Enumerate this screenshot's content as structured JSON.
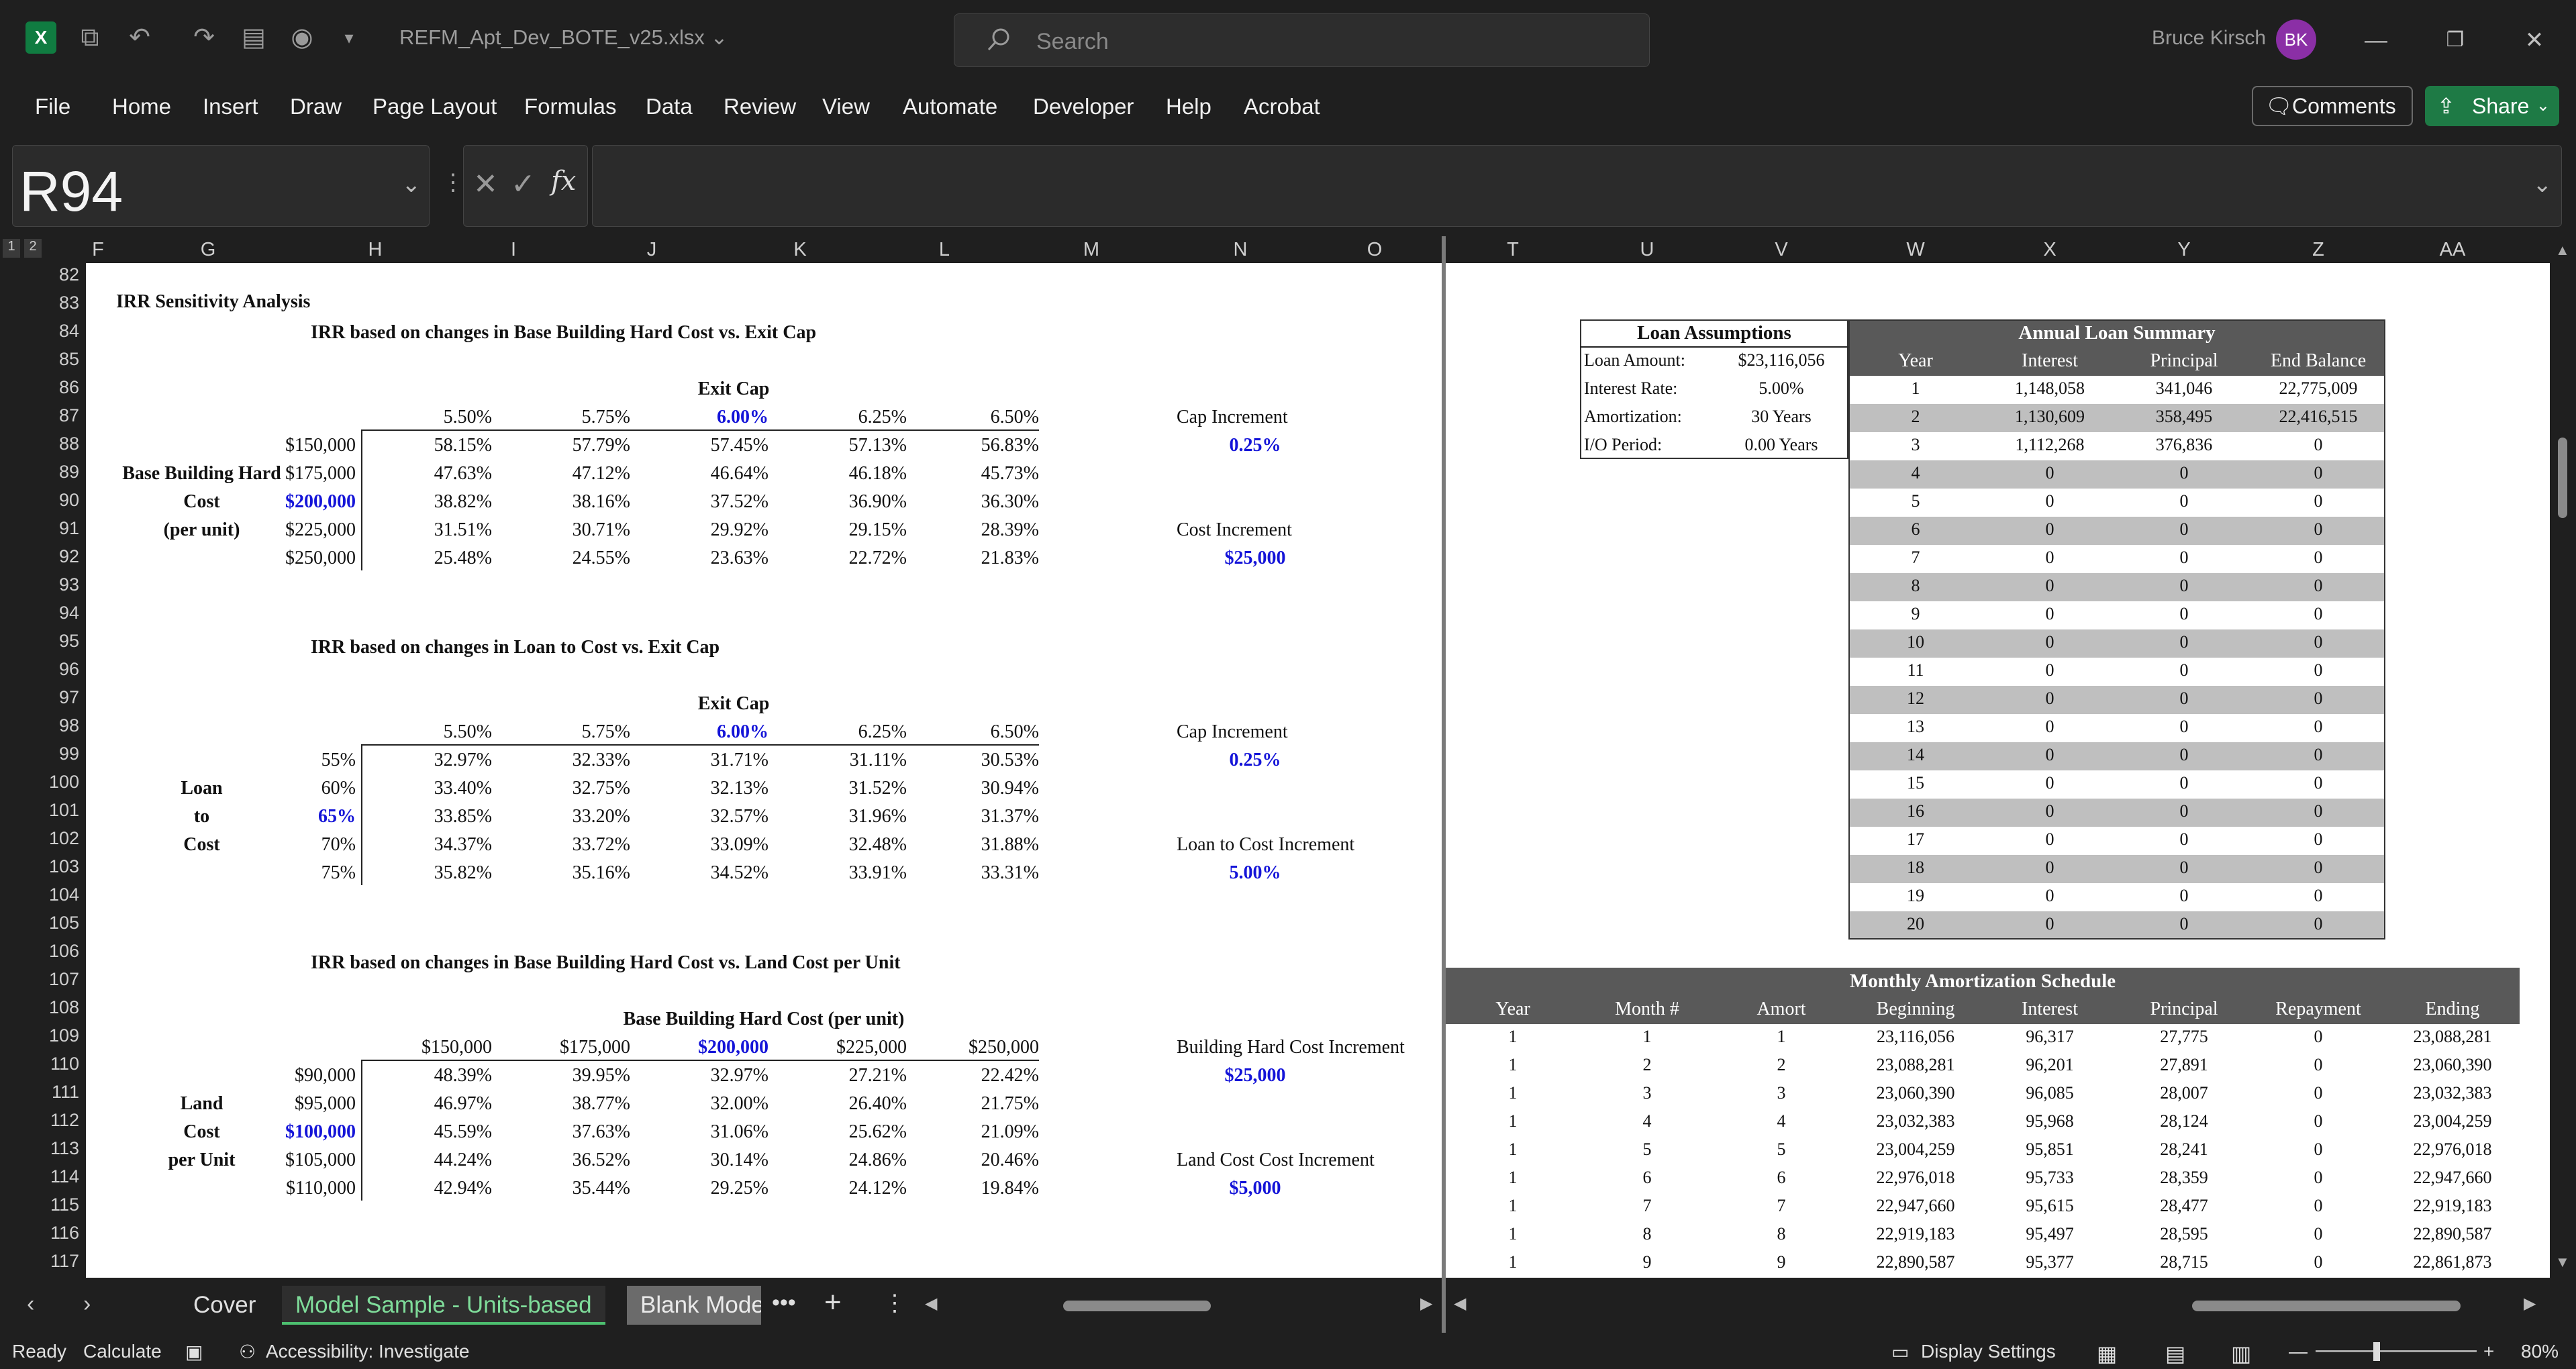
{
  "titlebar": {
    "file_name": "REFM_Apt_Dev_BOTE_v25.xlsx",
    "search_placeholder": "Search",
    "user_name": "Bruce Kirsch",
    "user_initials": "BK"
  },
  "menu": [
    "File",
    "Home",
    "Insert",
    "Draw",
    "Page Layout",
    "Formulas",
    "Data",
    "Review",
    "View",
    "Automate",
    "Developer",
    "Help",
    "Acrobat"
  ],
  "comments_label": "Comments",
  "share_label": "Share",
  "formula_bar": {
    "name_box": "R94",
    "fx": "fx",
    "formula": ""
  },
  "columns_left": [
    "F",
    "G",
    "H",
    "I",
    "J",
    "K",
    "L",
    "M",
    "N",
    "O"
  ],
  "columns_right": [
    "T",
    "U",
    "V",
    "W",
    "X",
    "Y",
    "Z",
    "AA"
  ],
  "outline_levels": [
    "1",
    "2"
  ],
  "rows": [
    "82",
    "83",
    "84",
    "85",
    "86",
    "87",
    "88",
    "89",
    "90",
    "91",
    "92",
    "93",
    "94",
    "95",
    "96",
    "97",
    "98",
    "99",
    "100",
    "101",
    "102",
    "103",
    "104",
    "105",
    "106",
    "107",
    "108",
    "109",
    "110",
    "111",
    "112",
    "113",
    "114",
    "115",
    "116",
    "117"
  ],
  "section_title": "IRR Sensitivity Analysis",
  "tables": [
    {
      "title": "IRR based on changes in Base Building Hard Cost vs. Exit Cap",
      "col_header": "Exit Cap",
      "cols": [
        "5.50%",
        "5.75%",
        "6.00%",
        "6.25%",
        "6.50%"
      ],
      "row_label": [
        "Base Building Hard",
        "Cost",
        "(per unit)"
      ],
      "rows": [
        "$150,000",
        "$175,000",
        "$200,000",
        "$225,000",
        "$250,000"
      ],
      "values": [
        [
          "58.15%",
          "57.79%",
          "57.45%",
          "57.13%",
          "56.83%"
        ],
        [
          "47.63%",
          "47.12%",
          "46.64%",
          "46.18%",
          "45.73%"
        ],
        [
          "38.82%",
          "38.16%",
          "37.52%",
          "36.90%",
          "36.30%"
        ],
        [
          "31.51%",
          "30.71%",
          "29.92%",
          "29.15%",
          "28.39%"
        ],
        [
          "25.48%",
          "24.55%",
          "23.63%",
          "22.72%",
          "21.83%"
        ]
      ],
      "inc1_label": "Cap Increment",
      "inc1_value": "0.25%",
      "inc2_label": "Cost Increment",
      "inc2_value": "$25,000"
    },
    {
      "title": "IRR based on changes in Loan to Cost vs. Exit Cap",
      "col_header": "Exit Cap",
      "cols": [
        "5.50%",
        "5.75%",
        "6.00%",
        "6.25%",
        "6.50%"
      ],
      "row_label": [
        "Loan",
        "to",
        "Cost"
      ],
      "rows": [
        "55%",
        "60%",
        "65%",
        "70%",
        "75%"
      ],
      "values": [
        [
          "32.97%",
          "32.33%",
          "31.71%",
          "31.11%",
          "30.53%"
        ],
        [
          "33.40%",
          "32.75%",
          "32.13%",
          "31.52%",
          "30.94%"
        ],
        [
          "33.85%",
          "33.20%",
          "32.57%",
          "31.96%",
          "31.37%"
        ],
        [
          "34.37%",
          "33.72%",
          "33.09%",
          "32.48%",
          "31.88%"
        ],
        [
          "35.82%",
          "35.16%",
          "34.52%",
          "33.91%",
          "33.31%"
        ]
      ],
      "inc1_label": "Cap Increment",
      "inc1_value": "0.25%",
      "inc2_label": "Loan to Cost Increment",
      "inc2_value": "5.00%"
    },
    {
      "title": "IRR based on changes in Base Building Hard Cost vs. Land Cost per Unit",
      "col_header": "Base Building Hard Cost (per unit)",
      "cols": [
        "$150,000",
        "$175,000",
        "$200,000",
        "$225,000",
        "$250,000"
      ],
      "row_label": [
        "Land",
        "Cost",
        "per Unit"
      ],
      "rows": [
        "$90,000",
        "$95,000",
        "$100,000",
        "$105,000",
        "$110,000"
      ],
      "values": [
        [
          "48.39%",
          "39.95%",
          "32.97%",
          "27.21%",
          "22.42%"
        ],
        [
          "46.97%",
          "38.77%",
          "32.00%",
          "26.40%",
          "21.75%"
        ],
        [
          "45.59%",
          "37.63%",
          "31.06%",
          "25.62%",
          "21.09%"
        ],
        [
          "44.24%",
          "36.52%",
          "30.14%",
          "24.86%",
          "20.46%"
        ],
        [
          "42.94%",
          "35.44%",
          "29.25%",
          "24.12%",
          "19.84%"
        ]
      ],
      "inc1_label": "Building Hard Cost Increment",
      "inc1_value": "$25,000",
      "inc2_label": "Land Cost Cost Increment",
      "inc2_value": "$5,000"
    }
  ],
  "loan_assumptions": {
    "title": "Loan Assumptions",
    "items": [
      [
        "Loan Amount:",
        "$23,116,056"
      ],
      [
        "Interest Rate:",
        "5.00%"
      ],
      [
        "Amortization:",
        "30 Years"
      ],
      [
        "I/O Period:",
        "0.00 Years"
      ]
    ]
  },
  "annual_summary": {
    "title": "Annual Loan Summary",
    "headers": [
      "Year",
      "Interest",
      "Principal",
      "End Balance"
    ],
    "rows": [
      [
        "1",
        "1,148,058",
        "341,046",
        "22,775,009"
      ],
      [
        "2",
        "1,130,609",
        "358,495",
        "22,416,515"
      ],
      [
        "3",
        "1,112,268",
        "376,836",
        "0"
      ],
      [
        "4",
        "0",
        "0",
        "0"
      ],
      [
        "5",
        "0",
        "0",
        "0"
      ],
      [
        "6",
        "0",
        "0",
        "0"
      ],
      [
        "7",
        "0",
        "0",
        "0"
      ],
      [
        "8",
        "0",
        "0",
        "0"
      ],
      [
        "9",
        "0",
        "0",
        "0"
      ],
      [
        "10",
        "0",
        "0",
        "0"
      ],
      [
        "11",
        "0",
        "0",
        "0"
      ],
      [
        "12",
        "0",
        "0",
        "0"
      ],
      [
        "13",
        "0",
        "0",
        "0"
      ],
      [
        "14",
        "0",
        "0",
        "0"
      ],
      [
        "15",
        "0",
        "0",
        "0"
      ],
      [
        "16",
        "0",
        "0",
        "0"
      ],
      [
        "17",
        "0",
        "0",
        "0"
      ],
      [
        "18",
        "0",
        "0",
        "0"
      ],
      [
        "19",
        "0",
        "0",
        "0"
      ],
      [
        "20",
        "0",
        "0",
        "0"
      ]
    ]
  },
  "monthly_schedule": {
    "title": "Monthly Amortization Schedule",
    "headers": [
      "Year",
      "Month #",
      "Amort",
      "Beginning",
      "Interest",
      "Principal",
      "Repayment",
      "Ending"
    ],
    "rows": [
      [
        "1",
        "1",
        "1",
        "23,116,056",
        "96,317",
        "27,775",
        "0",
        "23,088,281"
      ],
      [
        "1",
        "2",
        "2",
        "23,088,281",
        "96,201",
        "27,891",
        "0",
        "23,060,390"
      ],
      [
        "1",
        "3",
        "3",
        "23,060,390",
        "96,085",
        "28,007",
        "0",
        "23,032,383"
      ],
      [
        "1",
        "4",
        "4",
        "23,032,383",
        "95,968",
        "28,124",
        "0",
        "23,004,259"
      ],
      [
        "1",
        "5",
        "5",
        "23,004,259",
        "95,851",
        "28,241",
        "0",
        "22,976,018"
      ],
      [
        "1",
        "6",
        "6",
        "22,976,018",
        "95,733",
        "28,359",
        "0",
        "22,947,660"
      ],
      [
        "1",
        "7",
        "7",
        "22,947,660",
        "95,615",
        "28,477",
        "0",
        "22,919,183"
      ],
      [
        "1",
        "8",
        "8",
        "22,919,183",
        "95,497",
        "28,595",
        "0",
        "22,890,587"
      ],
      [
        "1",
        "9",
        "9",
        "22,890,587",
        "95,377",
        "28,715",
        "0",
        "22,861,873"
      ]
    ]
  },
  "sheet_tabs": [
    "Cover",
    "Model Sample - Units-based",
    "Blank Mode"
  ],
  "status": {
    "ready": "Ready",
    "calculate": "Calculate",
    "accessibility": "Accessibility: Investigate",
    "display_settings": "Display Settings",
    "zoom": "80%"
  },
  "colors": {
    "accent_blue": "#1414d8",
    "share_green": "#1e7a45",
    "avatar": "#8b2fa6",
    "table_header_bg": "#595959",
    "band_bg": "#bfbfbf"
  }
}
